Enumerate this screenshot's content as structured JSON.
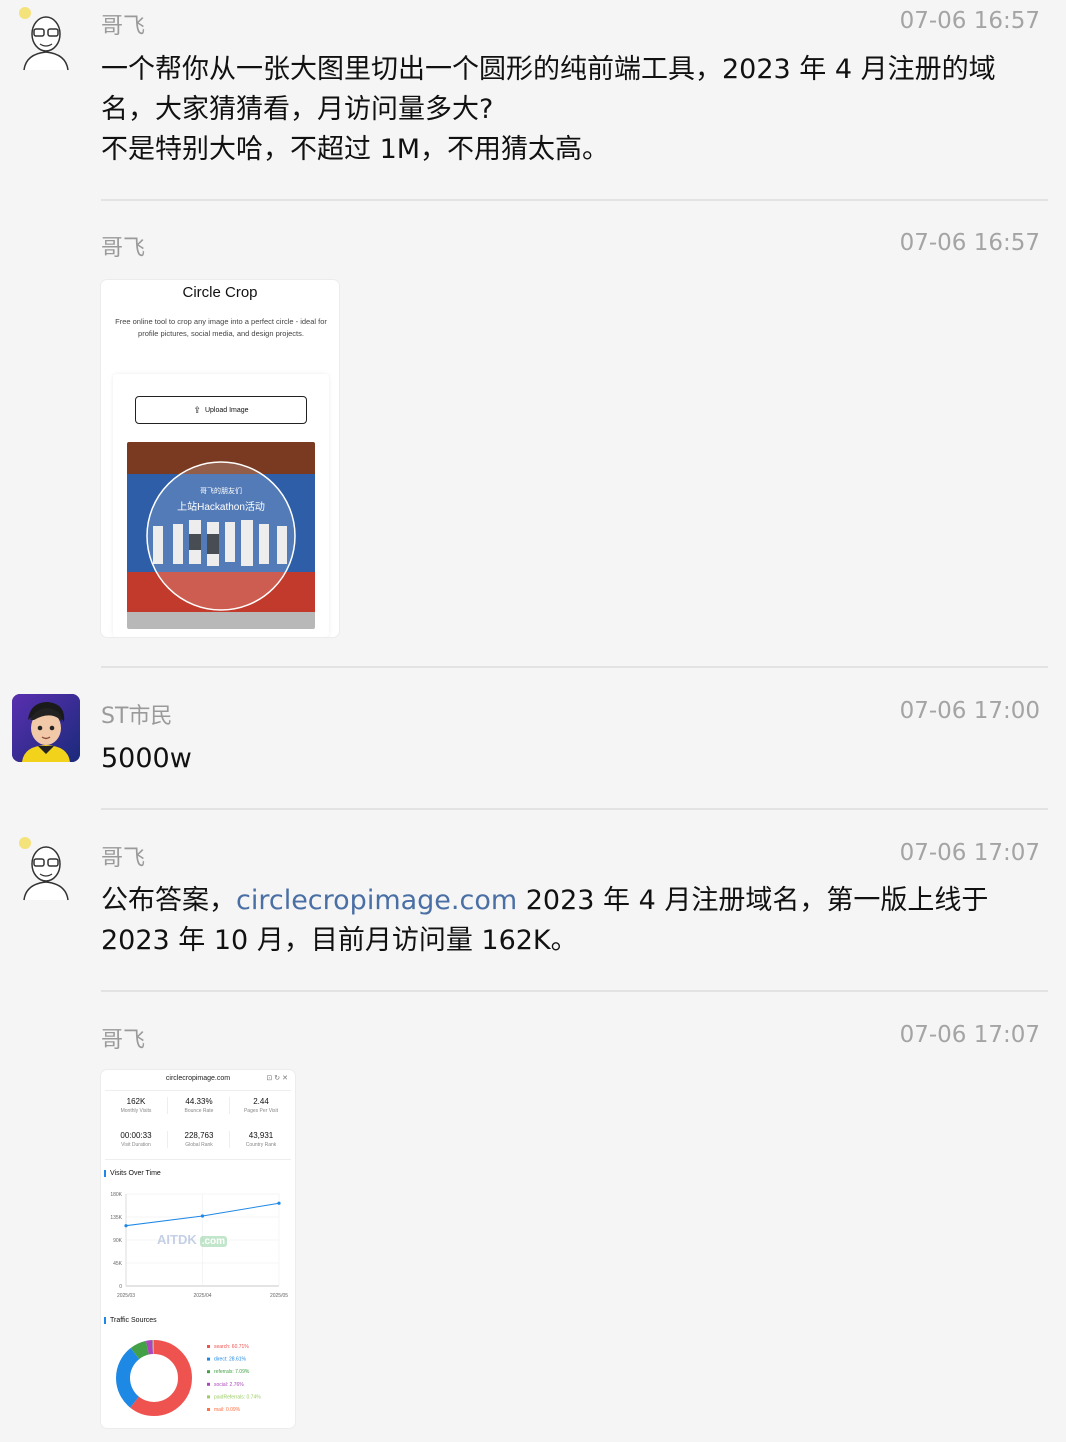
{
  "messages": [
    {
      "sender": "哥飞",
      "time": "07-06 16:57",
      "text": "一个帮你从一张大图里切出一个圆形的纯前端工具，2023 年 4 月注册的域名，大家猜猜看，月访问量多大?\n不是特别大哈，不超过 1M，不用猜太高。"
    },
    {
      "sender": "哥飞",
      "time": "07-06 16:57",
      "image": {
        "title": "Circle Crop",
        "subtitle": "Free online tool to crop any image into a perfect circle - ideal for profile pictures, social media, and design projects.",
        "button": "Upload Image",
        "photo_caption_1": "哥飞的朋友们",
        "photo_caption_2": "上站Hackathon活动"
      }
    },
    {
      "sender": "ST市民",
      "time": "07-06 17:00",
      "text": "5000w"
    },
    {
      "sender": "哥飞",
      "time": "07-06 17:07",
      "text_before": "公布答案，",
      "link": "circlecropimage.com",
      "text_after": " 2023 年 4 月注册域名，第一版上线于 2023 年 10 月，目前月访问量 162K。"
    },
    {
      "sender": "哥飞",
      "time": "07-06 17:07",
      "stats_card": {
        "domain": "circlecropimage.com",
        "stats": [
          {
            "value": "162K",
            "label": "Monthly Visits"
          },
          {
            "value": "44.33%",
            "label": "Bounce Rate"
          },
          {
            "value": "2.44",
            "label": "Pages Per Visit"
          },
          {
            "value": "00:00:33",
            "label": "Visit Duration"
          },
          {
            "value": "228,763",
            "label": "Global Rank"
          },
          {
            "value": "43,931",
            "label": "Country Rank"
          }
        ],
        "visits_title": "Visits Over Time",
        "traffic_title": "Traffic Sources",
        "watermark": "AITDK",
        "watermark_suffix": ".com"
      }
    }
  ],
  "chart_data": [
    {
      "type": "line",
      "title": "Visits Over Time",
      "categories": [
        "2025/03",
        "2025/04",
        "2025/05"
      ],
      "values": [
        118000,
        137000,
        162000
      ],
      "yticks": [
        "180K",
        "135K",
        "90K",
        "45K",
        "0"
      ],
      "ylim": [
        0,
        180000
      ],
      "color": "#1e88e5"
    },
    {
      "type": "pie",
      "title": "Traffic Sources",
      "labels": [
        "search: 60.71%",
        "direct: 28.61%",
        "referrals: 7.09%",
        "social: 2.76%",
        "paidReferrals: 0.74%",
        "mail: 0.09%"
      ],
      "values": [
        60.71,
        28.61,
        7.09,
        2.76,
        0.74,
        0.09
      ],
      "colors": [
        "#ef5350",
        "#1e88e5",
        "#43a047",
        "#ab47bc",
        "#9ccc65",
        "#ff7043"
      ]
    }
  ]
}
